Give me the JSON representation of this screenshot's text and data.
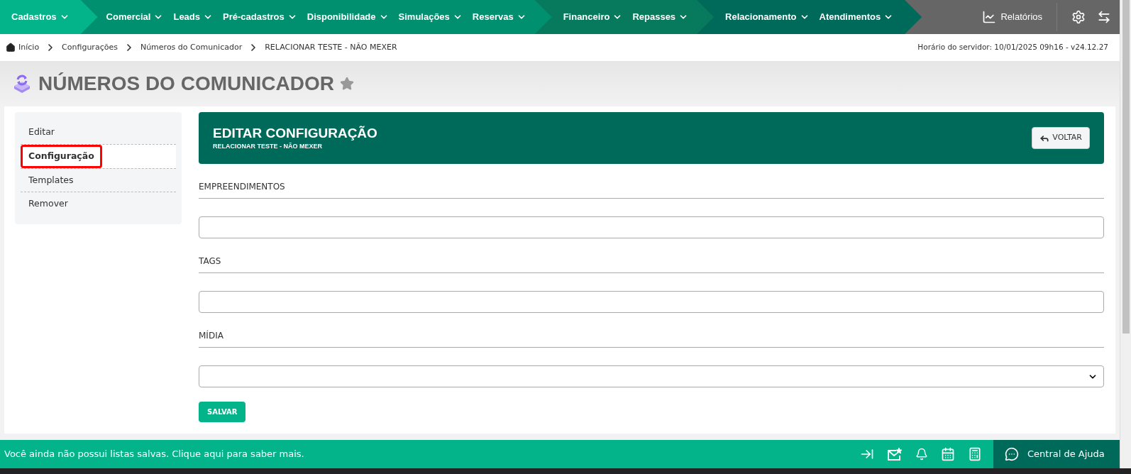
{
  "nav": {
    "groups": [
      {
        "items": [
          "Cadastros"
        ]
      },
      {
        "items": [
          "Comercial",
          "Leads",
          "Pré-cadastros",
          "Disponibilidade",
          "Simulações",
          "Reservas"
        ]
      },
      {
        "items": [
          "Financeiro",
          "Repasses"
        ]
      },
      {
        "items": [
          "Relacionamento",
          "Atendimentos"
        ]
      }
    ],
    "reports": "Relatórios"
  },
  "breadcrumb": [
    "Início",
    "Configurações",
    "Números do Comunicador",
    "RELACIONAR TESTE - NÃO MEXER"
  ],
  "server_time": "Horário do servidor: 10/01/2025 09h16 - v24.12.27",
  "page_title": "NÚMEROS DO COMUNICADOR",
  "sidebar": {
    "items": [
      {
        "label": "Editar",
        "selected": false
      },
      {
        "label": "Configuração",
        "selected": true
      },
      {
        "label": "Templates",
        "selected": false
      },
      {
        "label": "Remover",
        "selected": false
      }
    ]
  },
  "panel": {
    "title": "EDITAR CONFIGURAÇÃO",
    "subtitle": "RELACIONAR TESTE - NÃO MEXER",
    "back_button": "VOLTAR"
  },
  "form": {
    "sections": [
      {
        "label": "EMPREENDIMENTOS",
        "kind": "text"
      },
      {
        "label": "TAGS",
        "kind": "text"
      },
      {
        "label": "MÍDIA",
        "kind": "select"
      }
    ],
    "save_button": "SALVAR"
  },
  "footer": {
    "message": "Você ainda não possui listas salvas. Clique aqui para saber mais.",
    "help": "Central de Ajuda"
  }
}
